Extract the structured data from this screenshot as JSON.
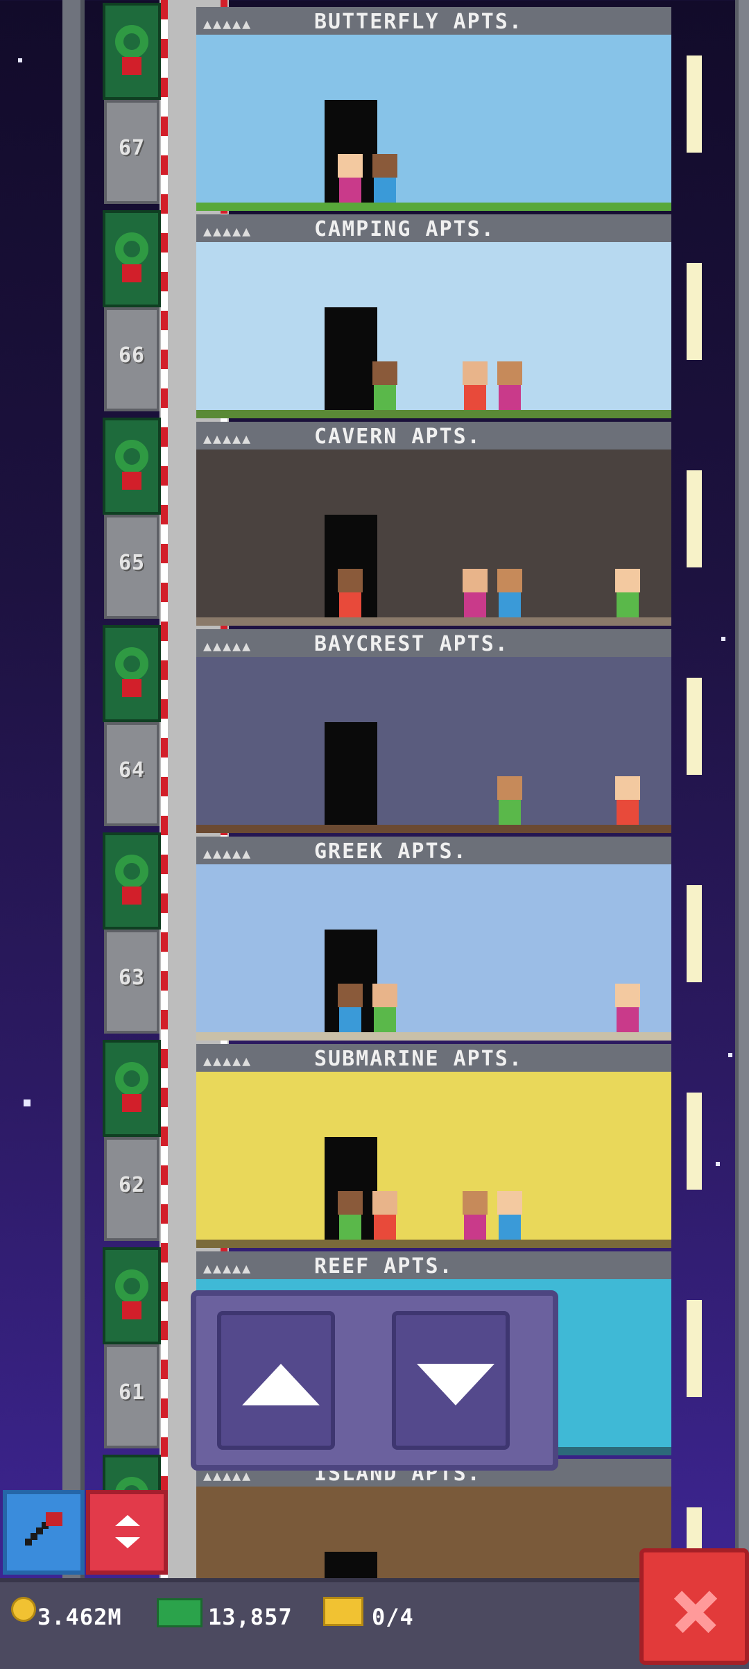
{
  "floors": [
    {
      "name": "BUTTERFLY APTS.",
      "elevator_number": "67",
      "theme": "butterfly garden",
      "wall": "#87c3e8",
      "ground": "#58a83a"
    },
    {
      "name": "CAMPING APTS.",
      "elevator_number": "66",
      "theme": "forest campsite",
      "wall": "#b7d9f0",
      "ground": "#5a8a36"
    },
    {
      "name": "CAVERN APTS.",
      "elevator_number": "65",
      "theme": "cave",
      "wall": "#4a423f",
      "ground": "#8a7a6a"
    },
    {
      "name": "BAYCREST APTS.",
      "elevator_number": "64",
      "theme": "kitchen",
      "wall": "#5a5c7e",
      "ground": "#6b4a32"
    },
    {
      "name": "GREEK APTS.",
      "elevator_number": "63",
      "theme": "greek columns",
      "wall": "#9bbde6",
      "ground": "#c9c0a8"
    },
    {
      "name": "SUBMARINE APTS.",
      "elevator_number": "62",
      "theme": "submarine",
      "wall": "#e9d85a",
      "ground": "#7a6a3a"
    },
    {
      "name": "REEF APTS.",
      "elevator_number": "61",
      "theme": "coral reef",
      "wall": "#3fb9d6",
      "ground": "#2c6a7a"
    },
    {
      "name": "ISLAND APTS.",
      "elevator_number": "",
      "theme": "tropical island",
      "wall": "#7a5a3a",
      "ground": "#6b4a2a"
    }
  ],
  "controls": {
    "up_icon": "arrow-up-icon",
    "down_icon": "arrow-down-icon",
    "left_button_icon": "hammer-icon",
    "right_button_icon": "updown-icon"
  },
  "status": {
    "coins": "3.462M",
    "bux": "13,857",
    "tickets": "0/4"
  },
  "colors": {
    "accent_red": "#e23a3a",
    "accent_blue": "#3a8cdc",
    "bar": "#4c4a60"
  }
}
